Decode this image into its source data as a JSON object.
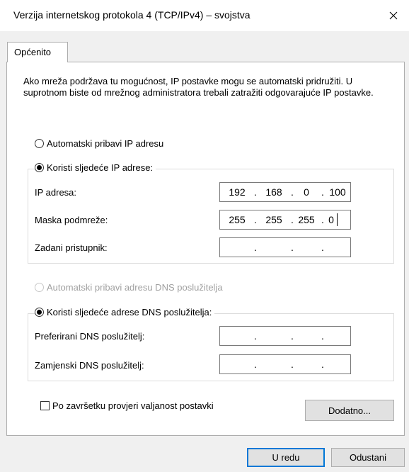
{
  "window": {
    "title": "Verzija internetskog protokola 4 (TCP/IPv4) – svojstva"
  },
  "tab": {
    "label": "Općenito"
  },
  "description": "Ako mreža podržava tu mogućnost, IP postavke mogu se automatski pridružiti. U suprotnom biste od mrežnog administratora trebali zatražiti odgovarajuće IP postavke.",
  "ip_section": {
    "auto_label": "Automatski pribavi IP adresu",
    "manual_label": "Koristi sljedeće IP adrese:",
    "selected": "manual",
    "fields": [
      {
        "label": "IP adresa:",
        "octets": [
          "192",
          "168",
          "0",
          "100"
        ]
      },
      {
        "label": "Maska podmreže:",
        "octets": [
          "255",
          "255",
          "255",
          "0"
        ]
      },
      {
        "label": "Zadani pristupnik:",
        "octets": [
          "",
          "",
          "",
          ""
        ]
      }
    ]
  },
  "dns_section": {
    "auto_label": "Automatski pribavi adresu DNS poslužitelja",
    "manual_label": "Koristi sljedeće adrese DNS poslužitelja:",
    "selected": "manual",
    "fields": [
      {
        "label": "Preferirani DNS poslužitelj:",
        "octets": [
          "",
          "",
          "",
          ""
        ]
      },
      {
        "label": "Zamjenski DNS poslužitelj:",
        "octets": [
          "",
          "",
          "",
          ""
        ]
      }
    ]
  },
  "validate_label": "Po završetku provjeri valjanost postavki",
  "validate_checked": false,
  "buttons": {
    "advanced": "Dodatno...",
    "ok": "U redu",
    "cancel": "Odustani"
  },
  "dot": "."
}
